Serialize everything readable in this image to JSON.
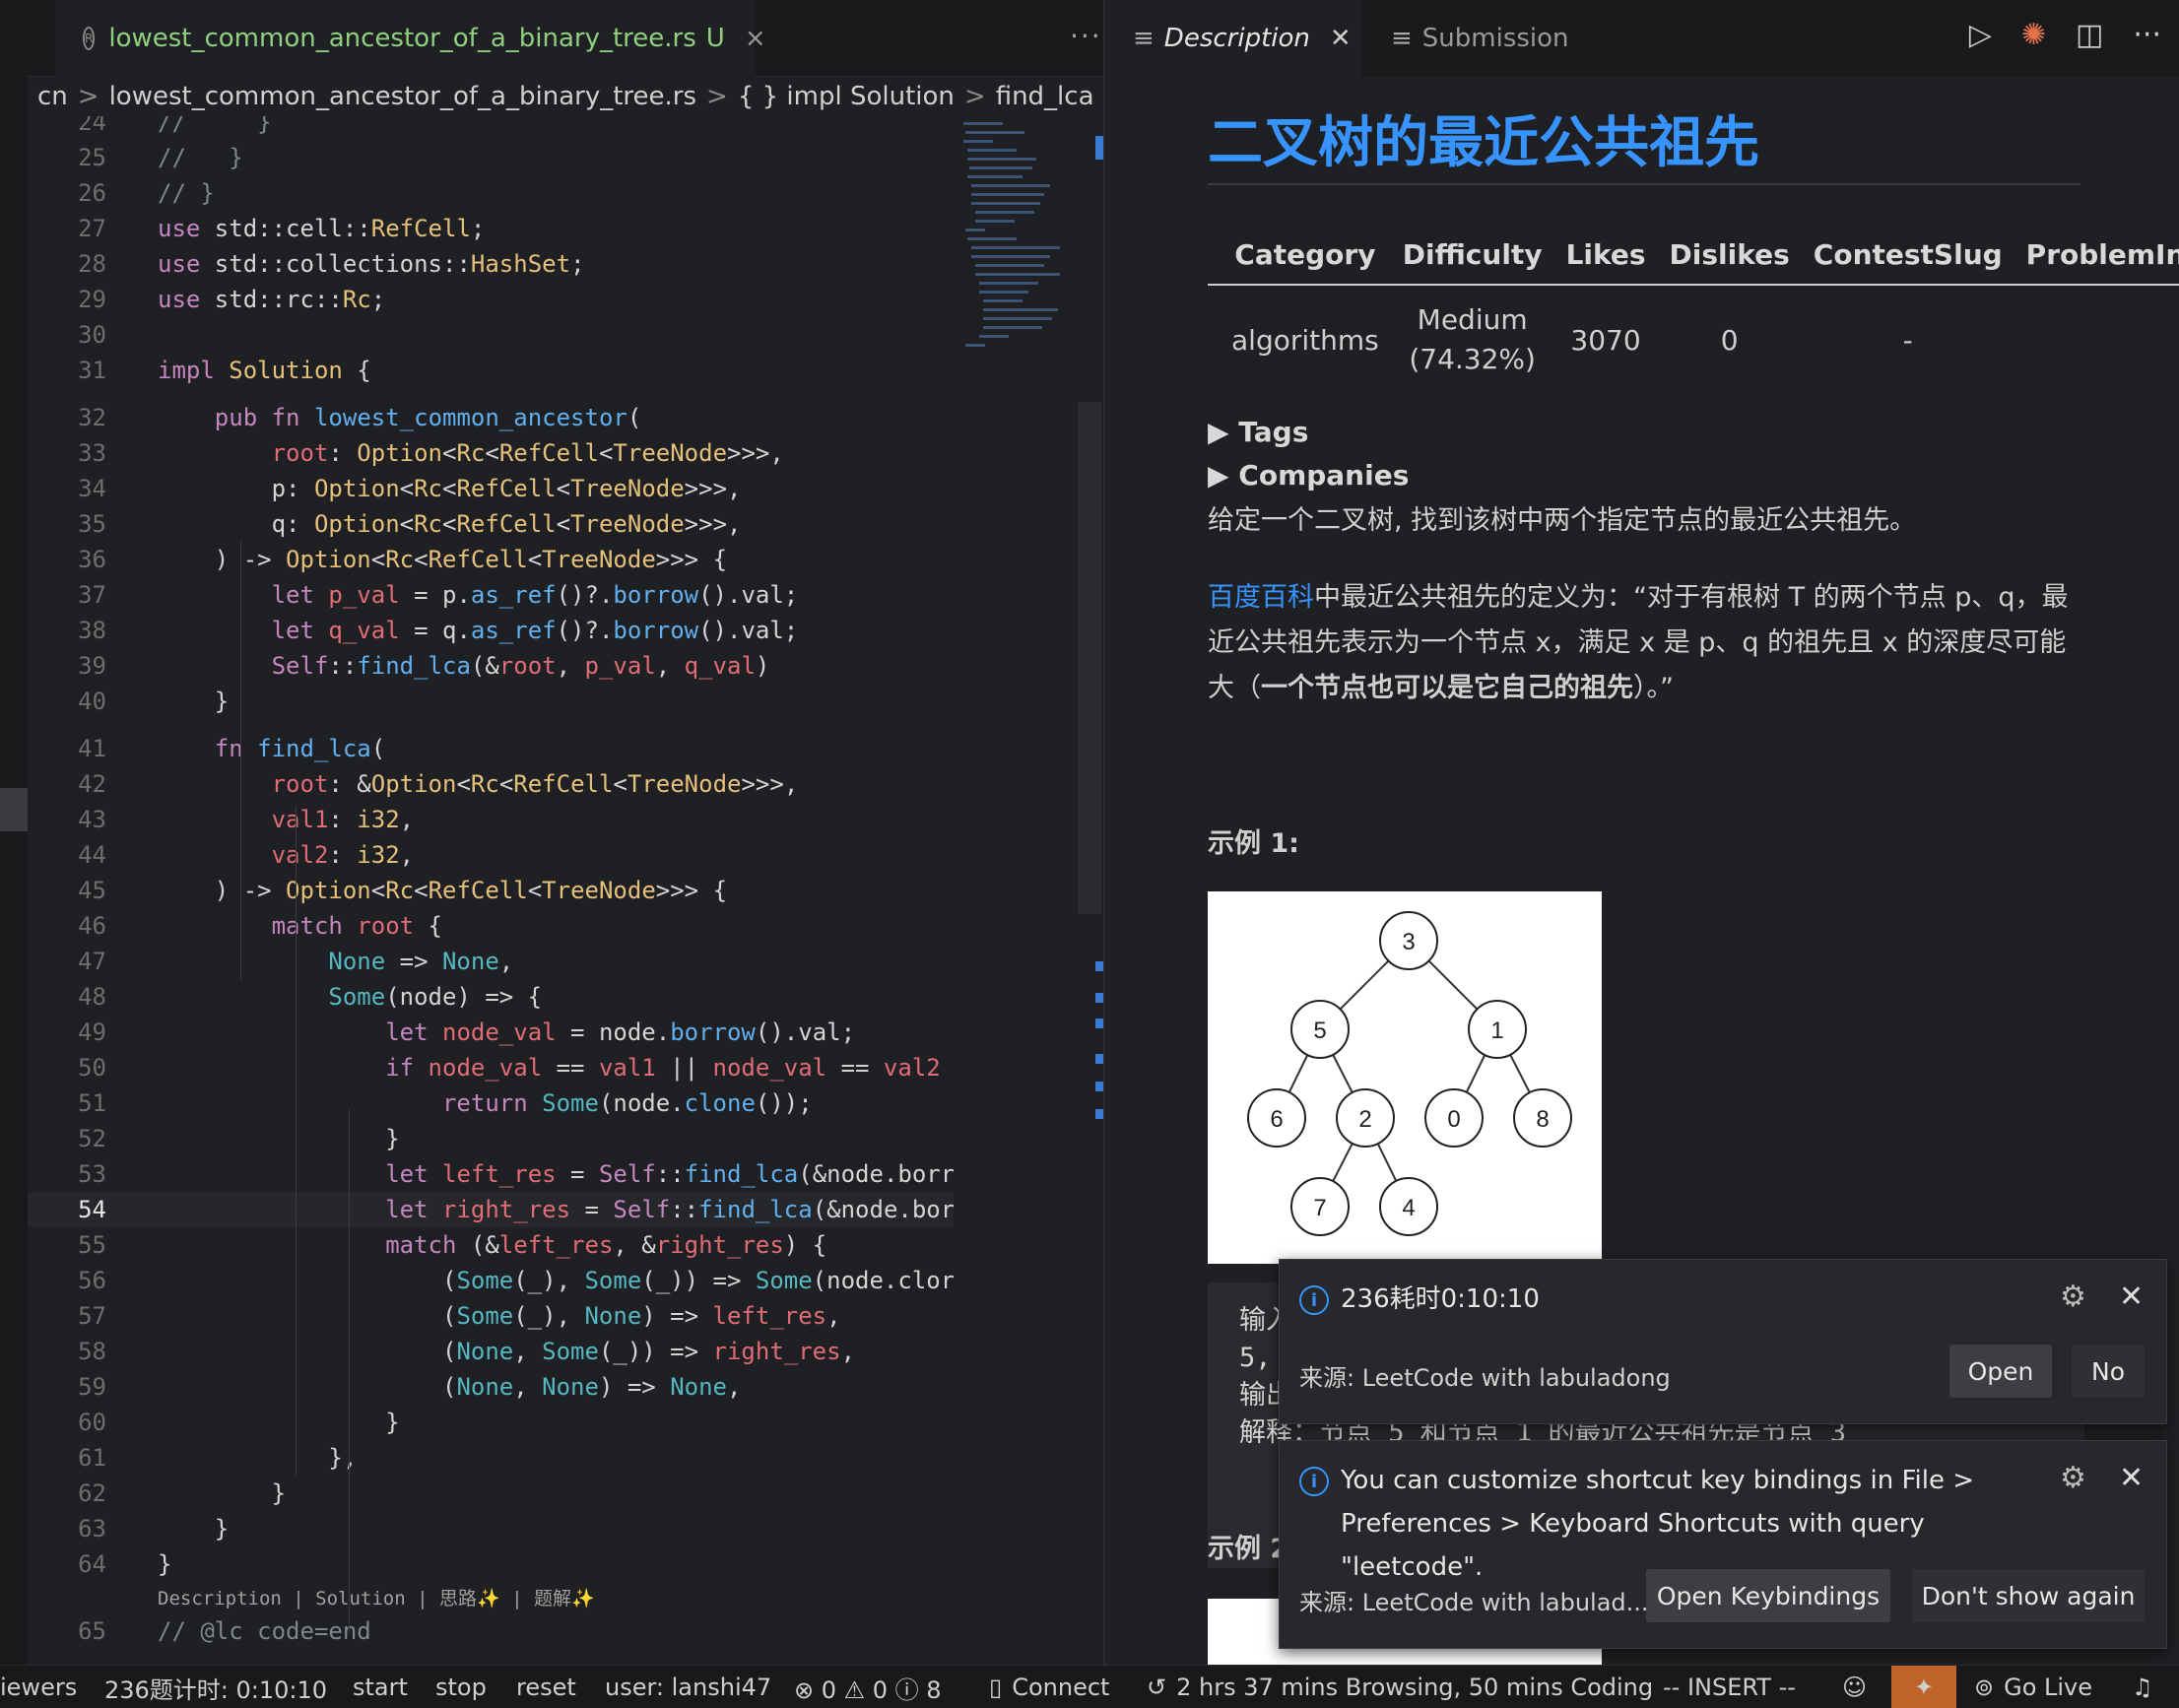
{
  "editor": {
    "tab": {
      "filename": "lowest_common_ancestor_of_a_binary_tree.rs",
      "badge": "U",
      "close": "×",
      "more": "···"
    },
    "breadcrumb": [
      "cn",
      ">",
      "lowest_common_ancestor_of_a_binary_tree.rs",
      ">",
      "{ } impl Solution",
      ">",
      "find_lca"
    ],
    "codelens": "Description | Solution | 思路✨ | 题解✨",
    "lines": [
      {
        "n": "24",
        "t": "//     }"
      },
      {
        "n": "25",
        "t": "//   }"
      },
      {
        "n": "26",
        "t": "// }"
      },
      {
        "n": "27",
        "t": "use std::cell::RefCell;"
      },
      {
        "n": "28",
        "t": "use std::collections::HashSet;"
      },
      {
        "n": "29",
        "t": "use std::rc::Rc;"
      },
      {
        "n": "30",
        "t": ""
      },
      {
        "n": "31",
        "t": "impl Solution {"
      },
      {
        "n": "32",
        "t": "    pub fn lowest_common_ancestor("
      },
      {
        "n": "33",
        "t": "        root: Option<Rc<RefCell<TreeNode>>>,"
      },
      {
        "n": "34",
        "t": "        p: Option<Rc<RefCell<TreeNode>>>,"
      },
      {
        "n": "35",
        "t": "        q: Option<Rc<RefCell<TreeNode>>>,"
      },
      {
        "n": "36",
        "t": "    ) -> Option<Rc<RefCell<TreeNode>>> {"
      },
      {
        "n": "37",
        "t": "        let p_val = p.as_ref()?.borrow().val;"
      },
      {
        "n": "38",
        "t": "        let q_val = q.as_ref()?.borrow().val;"
      },
      {
        "n": "39",
        "t": "        Self::find_lca(&root, p_val, q_val)"
      },
      {
        "n": "40",
        "t": "    }"
      },
      {
        "n": "41",
        "t": "    fn find_lca("
      },
      {
        "n": "42",
        "t": "        root: &Option<Rc<RefCell<TreeNode>>>,"
      },
      {
        "n": "43",
        "t": "        val1: i32,"
      },
      {
        "n": "44",
        "t": "        val2: i32,"
      },
      {
        "n": "45",
        "t": "    ) -> Option<Rc<RefCell<TreeNode>>> {"
      },
      {
        "n": "46",
        "t": "        match root {"
      },
      {
        "n": "47",
        "t": "            None => None,"
      },
      {
        "n": "48",
        "t": "            Some(node) => {"
      },
      {
        "n": "49",
        "t": "                let node_val = node.borrow().val;"
      },
      {
        "n": "50",
        "t": "                if node_val == val1 || node_val == val2"
      },
      {
        "n": "51",
        "t": "                    return Some(node.clone());"
      },
      {
        "n": "52",
        "t": "                }"
      },
      {
        "n": "53",
        "t": "                let left_res = Self::find_lca(&node.borr"
      },
      {
        "n": "54",
        "t": "                let right_res = Self::find_lca(&node.bor"
      },
      {
        "n": "55",
        "t": "                match (&left_res, &right_res) {"
      },
      {
        "n": "56",
        "t": "                    (Some(_), Some(_)) => Some(node.clor"
      },
      {
        "n": "57",
        "t": "                    (Some(_), None) => left_res,"
      },
      {
        "n": "58",
        "t": "                    (None, Some(_)) => right_res,"
      },
      {
        "n": "59",
        "t": "                    (None, None) => None,"
      },
      {
        "n": "60",
        "t": "                }"
      },
      {
        "n": "61",
        "t": "            },"
      },
      {
        "n": "62",
        "t": "        }"
      },
      {
        "n": "63",
        "t": "    }"
      },
      {
        "n": "64",
        "t": "}"
      },
      {
        "n": "65",
        "t": "// @lc code=end"
      }
    ]
  },
  "panel": {
    "tabs": [
      {
        "label": "Description",
        "active": true
      },
      {
        "label": "Submission",
        "active": false
      }
    ],
    "title": "二叉树的最近公共祖先",
    "table": {
      "headers": [
        "Category",
        "Difficulty",
        "Likes",
        "Dislikes",
        "ContestSlug",
        "ProblemInd"
      ],
      "row": [
        "algorithms",
        "Medium (74.32%)",
        "3070",
        "0",
        "-",
        "-"
      ]
    },
    "tags": "Tags",
    "companies": "Companies",
    "desc1": "给定一个二叉树, 找到该树中两个指定节点的最近公共祖先。",
    "desc2_link": "百度百科",
    "desc2_a": "中最近公共祖先的定义为：“对于有根树 T 的两个节点 p、q，最近公共祖先表示为一个节点 x，满足 x 是 p、q 的祖先且 x 的深度尽可能大（",
    "desc2_b": "一个节点也可以是它自己的祖先",
    "desc2_c": "）。”",
    "example1": "示例 1:",
    "example2": "示例 2",
    "tree_nodes": [
      "3",
      "5",
      "1",
      "6",
      "2",
      "0",
      "8",
      "7",
      "4"
    ],
    "code_lines": [
      "输入",
      "5,",
      "输出",
      "解释：节点 5 和节点 1 的最近公共祖先是节点 3"
    ]
  },
  "toasts": [
    {
      "message": "236耗时0:10:10",
      "source": "来源: LeetCode with labuladong",
      "primary": "Open",
      "secondary": "No"
    },
    {
      "message": "You can customize shortcut key bindings in File > Preferences > Keyboard Shortcuts with query \"leetcode\".",
      "source": "来源: LeetCode with labulad...",
      "primary": "Open Keybindings",
      "secondary": "Don't show again"
    }
  ],
  "status": {
    "viewers": "iewers",
    "timer": "236题计时: 0:10:10",
    "start": "start",
    "stop": "stop",
    "reset": "reset",
    "user": "user: lanshi47",
    "problems": "⊗ 0 ⚠ 0 ⓘ 8",
    "connect": "Connect",
    "wakatime": "2 hrs 37 mins Browsing, 50 mins Coding",
    "mode": "-- INSERT --",
    "golive": "Go Live"
  },
  "colors": {
    "accent": "#3794ff",
    "brand": "#c0632a",
    "background": "#1f2023"
  }
}
